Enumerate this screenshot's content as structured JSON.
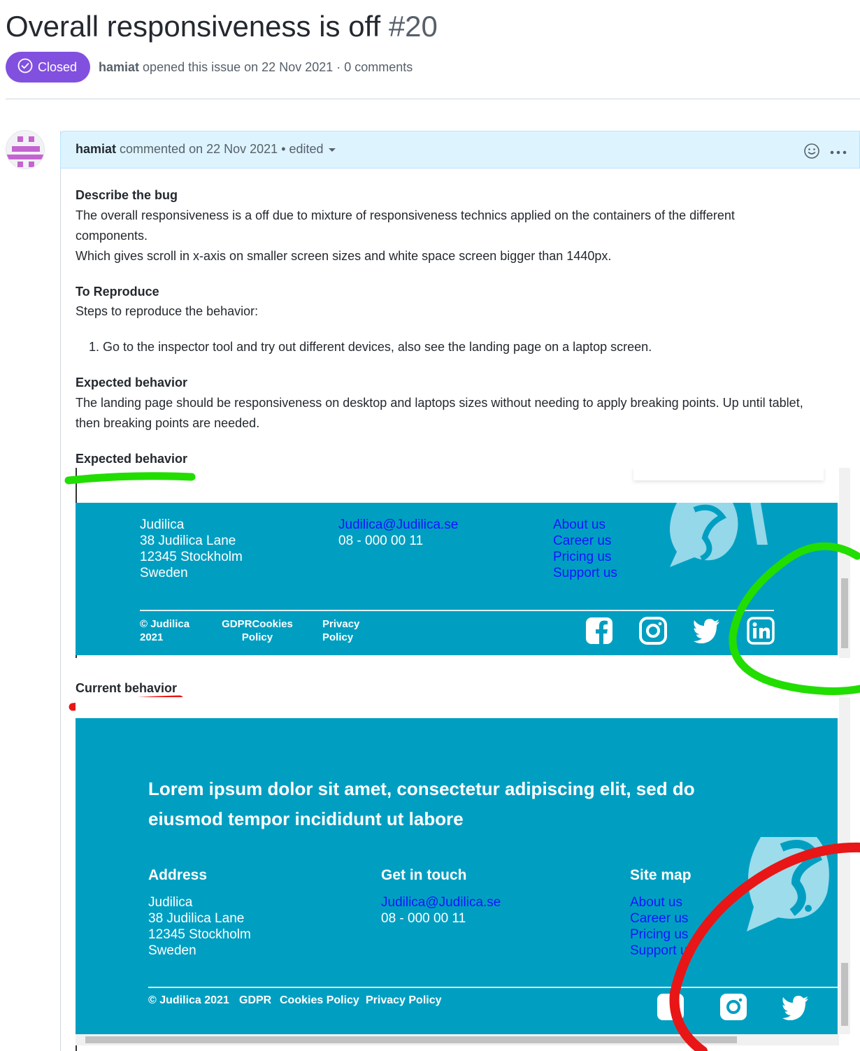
{
  "issue": {
    "title": "Overall responsiveness is off",
    "number": "#20",
    "status": "Closed",
    "author": "hamiat",
    "meta_text": "opened this issue on 22 Nov 2021 · 0 comments"
  },
  "comment": {
    "author": "hamiat",
    "meta_text": "commented on 22 Nov 2021 • edited",
    "sections": {
      "describe_heading": "Describe the bug",
      "describe_p1": "The overall responsiveness is a off due to mixture of responsiveness technics applied on the containers of the different components.",
      "describe_p2": "Which gives scroll in x-axis on smaller screen sizes and white space screen bigger than 1440px.",
      "reproduce_heading": "To Reproduce",
      "reproduce_intro": "Steps to reproduce the behavior:",
      "reproduce_step1": "Go to the inspector tool and try out different devices, also see the landing page on a laptop screen.",
      "expected_heading": "Expected behavior",
      "expected_text": "The landing page should be responsiveness on desktop and laptops sizes without needing to apply breaking points. Up until tablet, then breaking points are needed.",
      "expected_heading2": "Expected behavior",
      "current_heading": "Current behavior"
    }
  },
  "expected_shot": {
    "address": [
      "Judilica",
      "38 Judilica Lane",
      "12345 Stockholm",
      "Sweden"
    ],
    "contact": [
      "Judilica@Judilica.se",
      "08 - 000 00 11"
    ],
    "sitemap": [
      "About us",
      "Career us",
      "Pricing us",
      "Support us"
    ],
    "copyright": "© Judilica 2021",
    "gdpr": "GDPRCookies Policy",
    "privacy": "Privacy Policy"
  },
  "current_shot": {
    "headline": "Lorem ipsum dolor sit amet, consectetur adipiscing elit, sed do eiusmod tempor incididunt ut labore",
    "address_heading": "Address",
    "address": [
      "Judilica",
      "38 Judilica Lane",
      "12345 Stockholm",
      "Sweden"
    ],
    "contact_heading": "Get in touch",
    "contact": [
      "Judilica@Judilica.se",
      "08 - 000 00 11"
    ],
    "sitemap_heading": "Site map",
    "sitemap": [
      "About us",
      "Career us",
      "Pricing us",
      "Support us"
    ],
    "footer_links": [
      "© Judilica 2021",
      "GDPR",
      "Cookies Policy",
      "Privacy Policy"
    ]
  },
  "colors": {
    "closed_badge": "#8250df",
    "footer_bg": "#009fc2",
    "link_blue": "#1414ff",
    "highlight_green": "#22dd00",
    "highlight_red": "#e81616"
  },
  "icons": [
    "check-circle-icon",
    "chevron-down-icon",
    "smiley-icon",
    "kebab-icon",
    "facebook-icon",
    "instagram-icon",
    "twitter-icon",
    "linkedin-icon"
  ]
}
